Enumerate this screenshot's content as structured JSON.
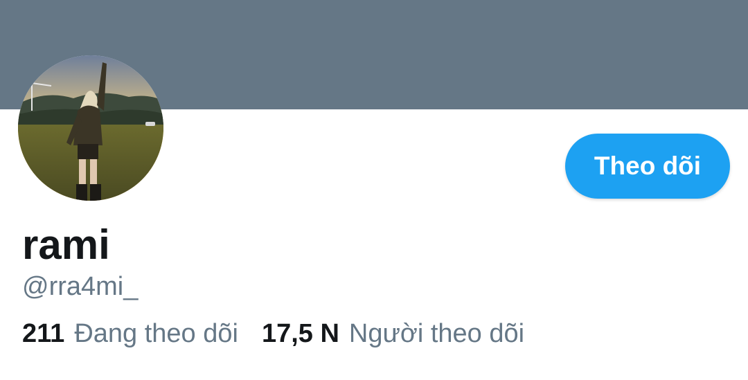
{
  "profile": {
    "display_name": "rami",
    "handle": "@rra4mi_",
    "follow_label": "Theo dõi"
  },
  "stats": {
    "following_count": "211",
    "following_label": "Đang theo dõi",
    "followers_count": "17,5 N",
    "followers_label": "Người theo dõi"
  },
  "colors": {
    "banner": "#657786",
    "accent": "#1da1f2",
    "text_primary": "#14171a",
    "text_secondary": "#657786"
  }
}
